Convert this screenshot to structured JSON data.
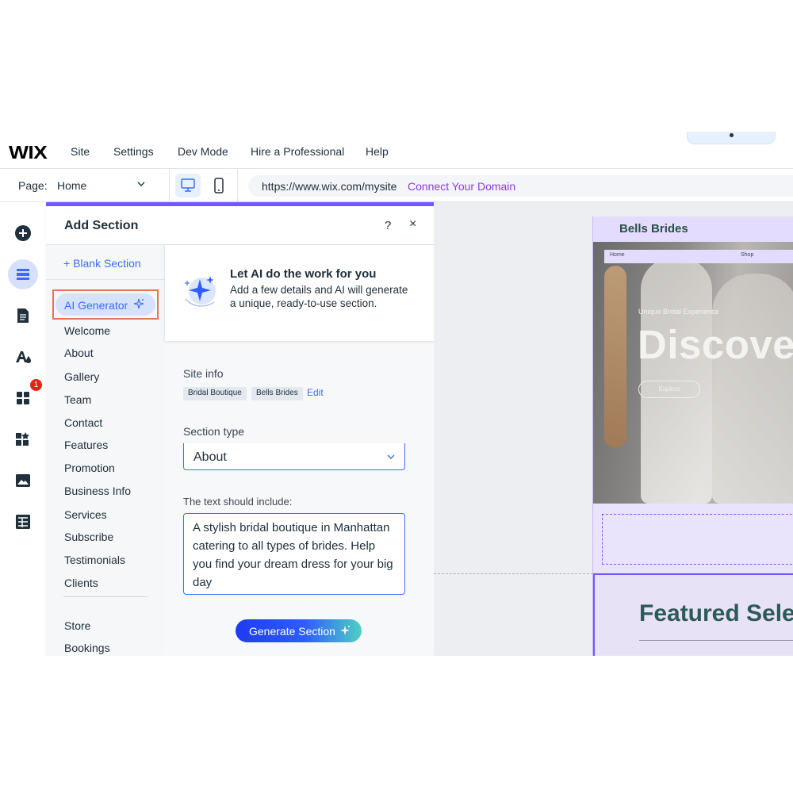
{
  "topbar": {
    "logo": "WIX",
    "menu": [
      "Site",
      "Settings",
      "Dev Mode",
      "Hire a Professional",
      "Help"
    ]
  },
  "secondbar": {
    "page_label": "Page:",
    "page_value": "Home",
    "url": "https://www.wix.com/mysite",
    "connect_domain": "Connect Your Domain"
  },
  "rail": {
    "badge": "1",
    "icons": [
      "add-icon",
      "sections-icon",
      "pages-icon",
      "theme-icon",
      "apps-icon",
      "business-apps-icon",
      "media-icon",
      "cms-icon"
    ]
  },
  "panel": {
    "title": "Add Section",
    "help": "?",
    "close": "×",
    "blank_section": "+ Blank Section",
    "ai_generator": "AI Generator",
    "categories": [
      "Welcome",
      "About",
      "Gallery",
      "Team",
      "Contact",
      "Features",
      "Promotion",
      "Business Info",
      "Services",
      "Subscribe",
      "Testimonials",
      "Clients"
    ],
    "categories_more": [
      "Store",
      "Bookings"
    ],
    "promo": {
      "title": "Let AI do the work for you",
      "text": "Add a few details and AI will generate a unique, ready-to-use section."
    },
    "site_info_label": "Site info",
    "chips": [
      "Bridal Boutique",
      "Bells Brides"
    ],
    "edit": "Edit",
    "section_type_label": "Section type",
    "section_type_value": "About",
    "text_include_label": "The text should include:",
    "text_include_value": "A stylish bridal boutique in Manhattan catering to all types of brides. Help you find your dream dress for your big day",
    "generate_label": "Generate Section"
  },
  "site": {
    "name": "Bells Brides",
    "nav": [
      "Home",
      "Shop"
    ],
    "kicker": "Unique Bridal Experience",
    "hero_title": "Discover",
    "explore": "Explore",
    "featured": "Featured Selection"
  },
  "colors": {
    "accent": "#3b6cf5",
    "panel_top": "#7357ff",
    "domain_link": "#8f3bd9",
    "highlight": "#e8735a"
  }
}
